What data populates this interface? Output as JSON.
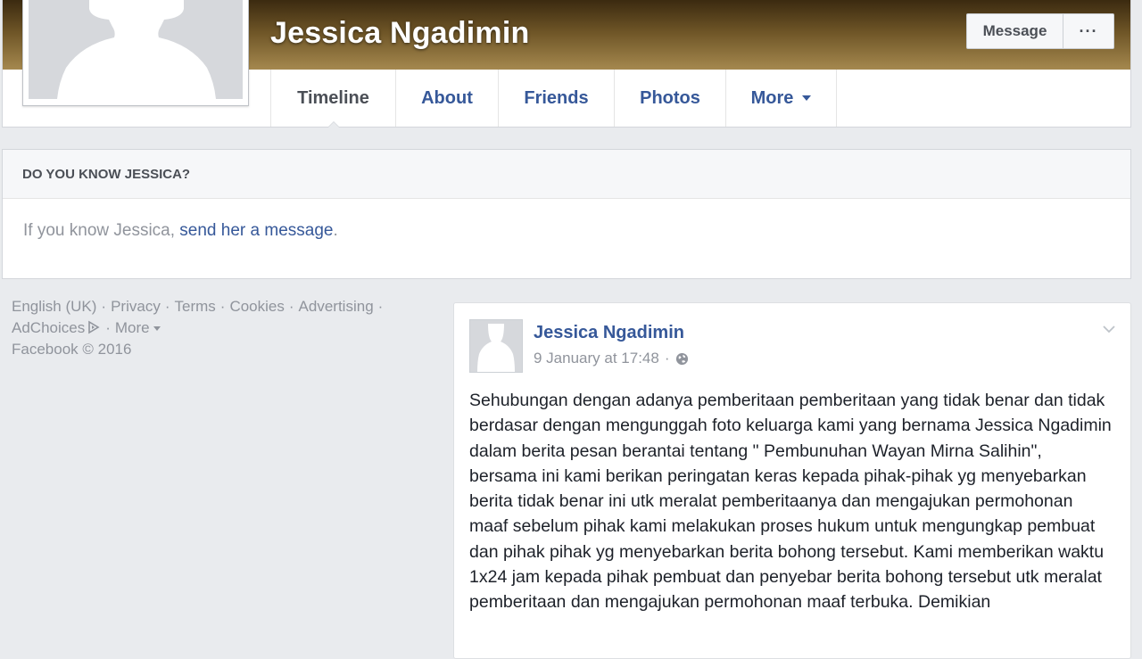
{
  "profile": {
    "name": "Jessica Ngadimin",
    "actions": {
      "message_label": "Message",
      "more_label": "···"
    }
  },
  "tabs": [
    {
      "label": "Timeline",
      "active": true
    },
    {
      "label": "About"
    },
    {
      "label": "Friends"
    },
    {
      "label": "Photos"
    },
    {
      "label": "More"
    }
  ],
  "know_card": {
    "heading": "DO YOU KNOW JESSICA?",
    "prefix": "If you know Jessica, ",
    "link": "send her a message",
    "suffix": "."
  },
  "footer": {
    "links": [
      "English (UK)",
      "Privacy",
      "Terms",
      "Cookies",
      "Advertising"
    ],
    "adchoices": "AdChoices",
    "more": "More",
    "copyright": "Facebook © 2016"
  },
  "post": {
    "author": "Jessica Ngadimin",
    "timestamp": "9 January at 17:48",
    "meta_sep": "·",
    "text": "Sehubungan dengan adanya pemberitaan pemberitaan yang tidak benar dan tidak berdasar dengan mengunggah foto keluarga kami yang bernama Jessica Ngadimin dalam berita pesan berantai tentang \" Pembunuhan Wayan Mirna Salihin\", bersama ini kami berikan peringatan keras kepada pihak-pihak yg menyebarkan berita tidak benar ini utk meralat pemberitaanya dan mengajukan permohonan maaf sebelum pihak kami melakukan proses hukum untuk mengungkap pembuat dan pihak pihak yg menyebarkan berita bohong tersebut. Kami memberikan waktu 1x24 jam kepada pihak pembuat dan penyebar berita bohong tersebut utk meralat pemberitaan dan mengajukan permohonan maaf terbuka. Demikian"
  },
  "colors": {
    "link": "#365899",
    "muted": "#90949c",
    "background": "#e9ebee"
  }
}
